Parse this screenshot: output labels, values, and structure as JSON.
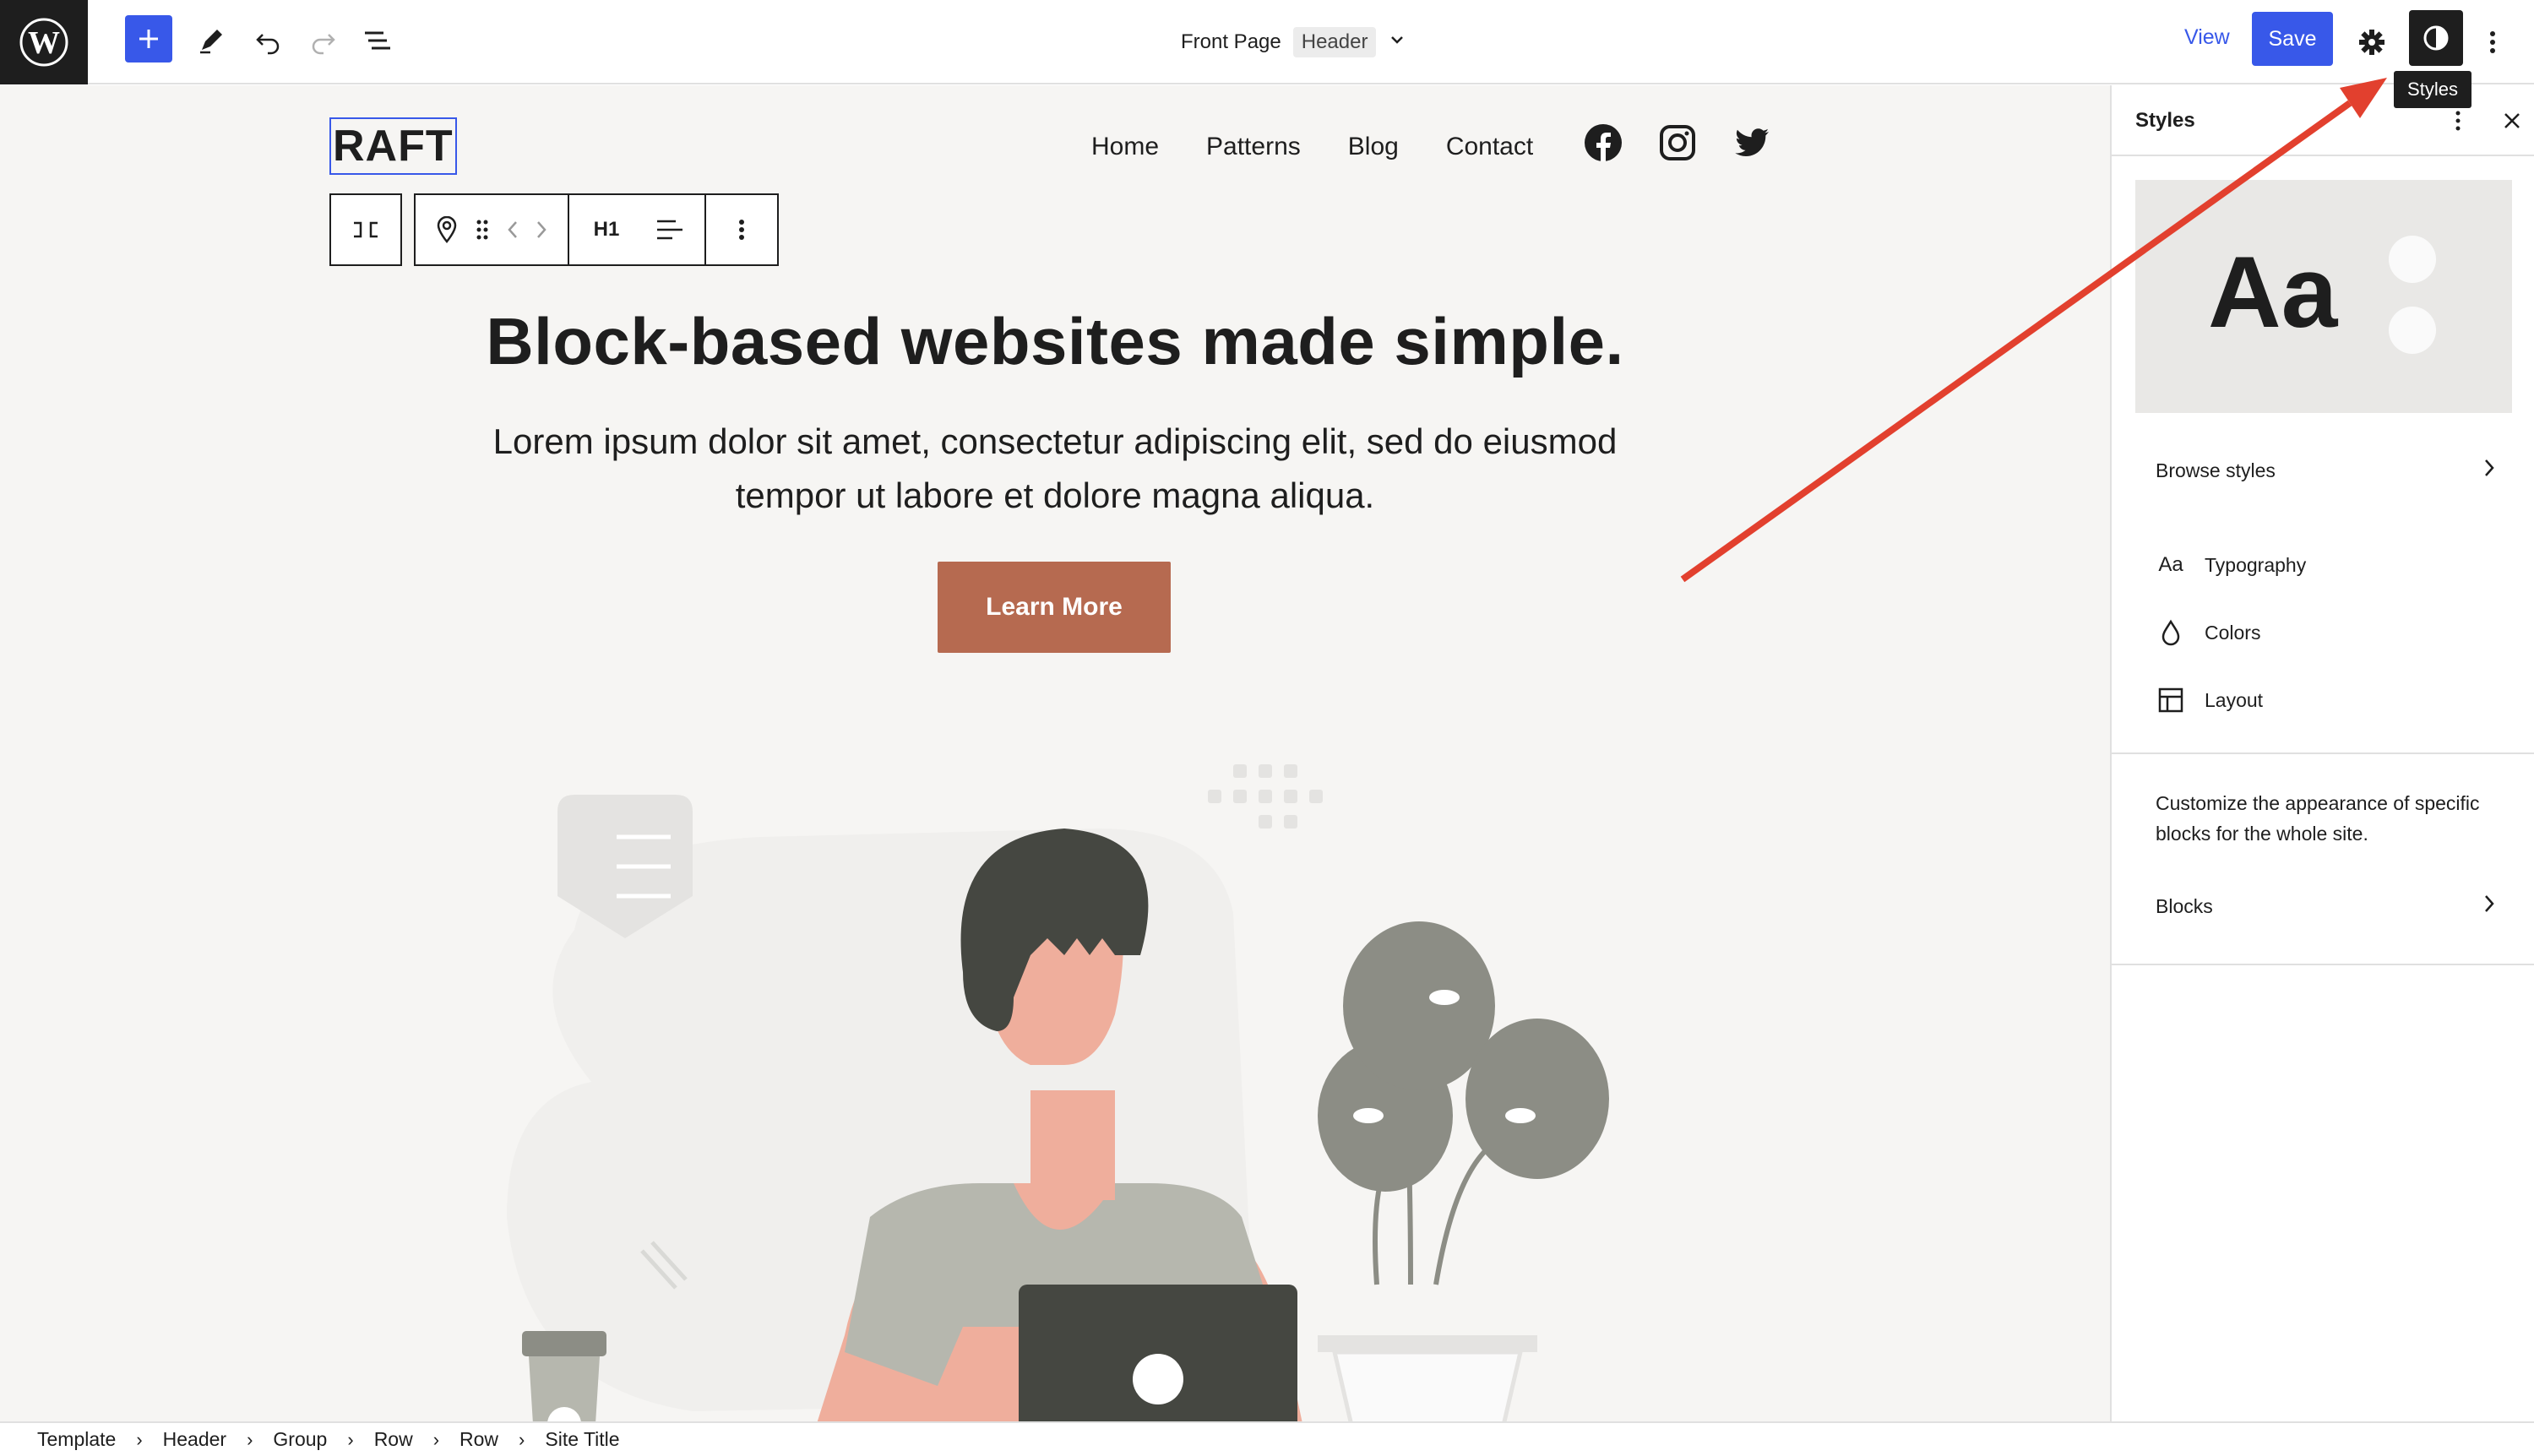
{
  "toolbar": {
    "document_title": "Front Page",
    "document_badge": "Header",
    "view_label": "View",
    "save_label": "Save",
    "tooltip": "Styles"
  },
  "site": {
    "title": "RAFT",
    "nav": [
      "Home",
      "Patterns",
      "Blog",
      "Contact"
    ]
  },
  "block_toolbar": {
    "heading_level": "H1"
  },
  "hero": {
    "title": "Block-based websites made simple.",
    "text": "Lorem ipsum dolor sit amet, consectetur adipiscing elit, sed do eiusmod tempor ut labore et dolore magna aliqua.",
    "button": "Learn More"
  },
  "sidebar": {
    "title": "Styles",
    "preview_text": "Aa",
    "browse_label": "Browse styles",
    "items": [
      {
        "label": "Typography",
        "icon": "typography-icon",
        "icon_glyph": "Aa"
      },
      {
        "label": "Colors",
        "icon": "droplet-icon"
      },
      {
        "label": "Layout",
        "icon": "layout-icon"
      }
    ],
    "description": "Customize the appearance of specific blocks for the whole site.",
    "blocks_label": "Blocks"
  },
  "breadcrumbs": [
    "Template",
    "Header",
    "Group",
    "Row",
    "Row",
    "Site Title"
  ],
  "colors": {
    "accent": "#3858e9",
    "cta": "#b66a50",
    "annotation_arrow": "#e2402e",
    "canvas_bg": "#f6f5f3"
  }
}
